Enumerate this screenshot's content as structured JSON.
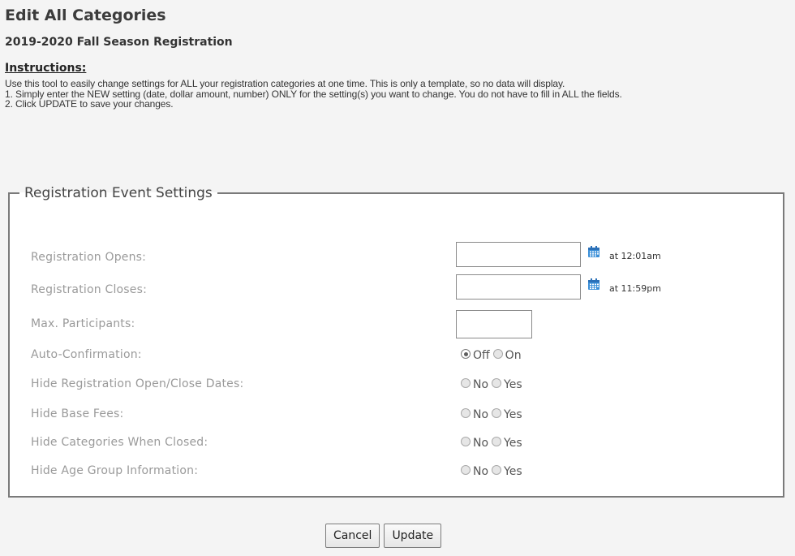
{
  "page": {
    "title": "Edit All Categories",
    "subtitle": "2019-2020 Fall Season Registration"
  },
  "instructions": {
    "heading": "Instructions:",
    "lines": [
      "Use this tool to easily change settings for ALL your registration categories at one time. This is only a template, so no data will display.",
      "1. Simply enter the NEW setting (date, dollar amount, number) ONLY for the setting(s) you want to change. You do not have to fill in ALL the fields.",
      "2. Click UPDATE to save your changes."
    ]
  },
  "settings": {
    "legend": "Registration Event Settings",
    "registration_opens": {
      "label": "Registration Opens:",
      "value": "",
      "time_note": "at 12:01am"
    },
    "registration_closes": {
      "label": "Registration Closes:",
      "value": "",
      "time_note": "at 11:59pm"
    },
    "max_participants": {
      "label": "Max. Participants:",
      "value": ""
    },
    "auto_confirmation": {
      "label": "Auto-Confirmation:",
      "options": [
        "Off",
        "On"
      ],
      "selected": "Off"
    },
    "hide_reg_dates": {
      "label": "Hide Registration Open/Close Dates:",
      "options": [
        "No",
        "Yes"
      ],
      "selected": ""
    },
    "hide_base_fees": {
      "label": "Hide Base Fees:",
      "options": [
        "No",
        "Yes"
      ],
      "selected": ""
    },
    "hide_categories_closed": {
      "label": "Hide Categories When Closed:",
      "options": [
        "No",
        "Yes"
      ],
      "selected": ""
    },
    "hide_age_group": {
      "label": "Hide Age Group Information:",
      "options": [
        "No",
        "Yes"
      ],
      "selected": ""
    }
  },
  "buttons": {
    "cancel": "Cancel",
    "update": "Update"
  },
  "icons": {
    "calendar": "calendar-icon"
  },
  "colors": {
    "calendar_icon": "#3a8fd8",
    "label_gray": "#9a9a9a"
  }
}
